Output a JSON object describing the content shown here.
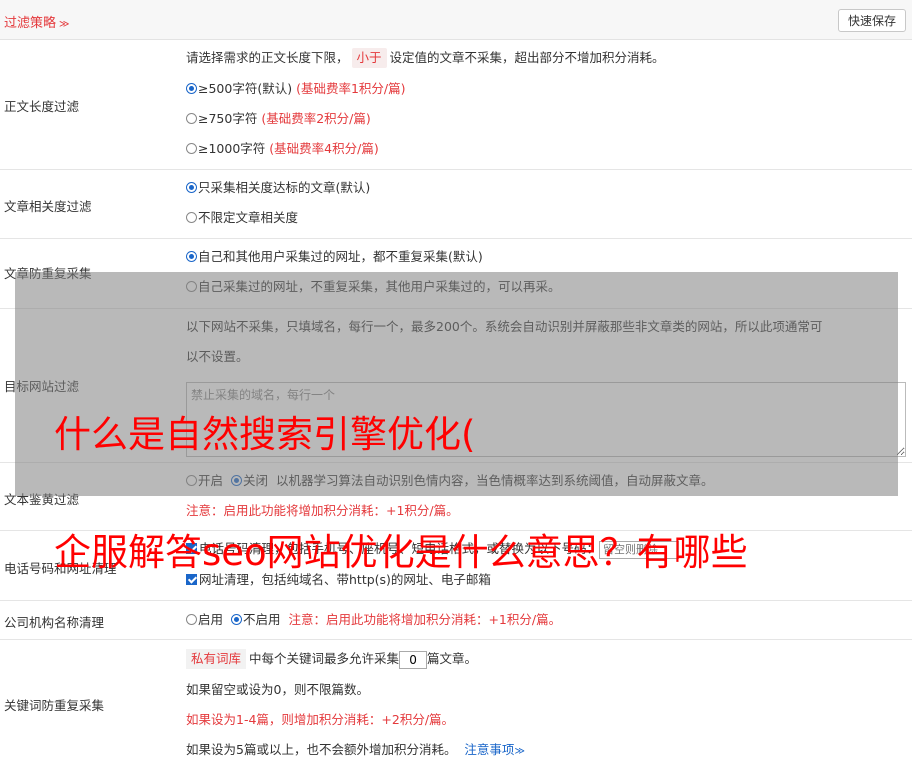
{
  "header": {
    "title": "过滤策略",
    "chevron": "≫",
    "save_label": "快速保存"
  },
  "rows": {
    "length": {
      "label": "正文长度过滤",
      "desc_pre": "请选择需求的正文长度下限，",
      "desc_tag": "小于",
      "desc_post": "设定值的文章不采集，超出部分不增加积分消耗。",
      "options": [
        {
          "label": "≥500字符(默认)",
          "note": "(基础费率1积分/篇)"
        },
        {
          "label": "≥750字符",
          "note": "(基础费率2积分/篇)"
        },
        {
          "label": "≥1000字符",
          "note": "(基础费率4积分/篇)"
        }
      ]
    },
    "relevance": {
      "label": "文章相关度过滤",
      "options": [
        "只采集相关度达标的文章(默认)",
        "不限定文章相关度"
      ]
    },
    "dedupe": {
      "label": "文章防重复采集",
      "options": [
        "自己和其他用户采集过的网址，都不重复采集(默认)",
        "自己采集过的网址，不重复采集，其他用户采集过的，可以再采。"
      ]
    },
    "site_filter": {
      "label": "目标网站过滤",
      "desc_line1": "以下网站不采集，只填域名，每行一个，最多200个。系统会自动识别并屏蔽那些非文章类的网站，所以此项通常可",
      "desc_line2": "以不设置。",
      "placeholder": "禁止采集的域名，每行一个"
    },
    "porn": {
      "label": "文本鉴黄过滤",
      "opt_on": "开启",
      "opt_off": "关闭",
      "desc": "以机器学习算法自动识别色情内容，当色情概率达到系统阈值，自动屏蔽文章。",
      "note": "注意：启用此功能将增加积分消耗：+1积分/篇。"
    },
    "phone": {
      "label": "电话号码和网址清理",
      "line1": "电话号码清理，包括手机号、座机号、短电话格式，或替换为以下号码：",
      "input_placeholder": "留空则删除",
      "line2": "网址清理，包括纯域名、带http(s)的网址、电子邮箱"
    },
    "company": {
      "label": "公司机构名称清理",
      "opt_on": "启用",
      "opt_off": "不启用",
      "note": "注意：启用此功能将增加积分消耗：+1积分/篇。"
    },
    "keyword": {
      "label": "关键词防重复采集",
      "tag": "私有词库",
      "line1_pre": "中每个关键词最多允许采集",
      "value": "0",
      "line1_post": "篇文章。",
      "line2": "如果留空或设为0，则不限篇数。",
      "line3": "如果设为1-4篇，则增加积分消耗：+2积分/篇。",
      "line4": "如果设为5篇或以上，也不会额外增加积分消耗。",
      "link": "注意事项",
      "link_chevron": "≫"
    }
  },
  "overlay": {
    "line1": "什么是自然搜索引擎优化(",
    "line2": "企服解答seo网站优化是什么意思？有哪些"
  }
}
